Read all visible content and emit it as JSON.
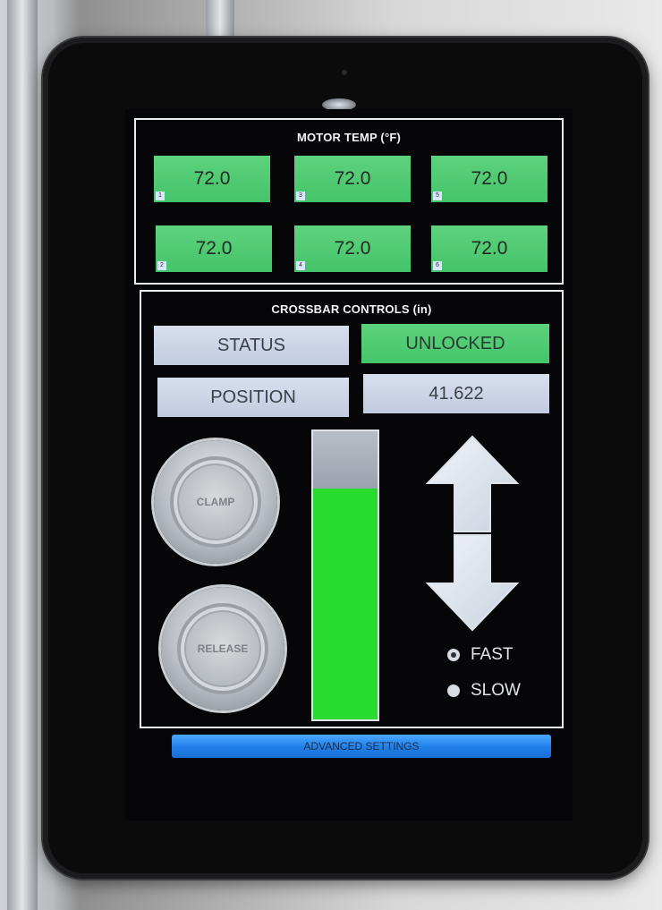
{
  "motor_temp": {
    "title": "MOTOR TEMP (°F)",
    "sensors": [
      {
        "index": "1",
        "value": "72.0"
      },
      {
        "index": "3",
        "value": "72.0"
      },
      {
        "index": "5",
        "value": "72.0"
      },
      {
        "index": "2",
        "value": "72.0"
      },
      {
        "index": "4",
        "value": "72.0"
      },
      {
        "index": "6",
        "value": "72.0"
      }
    ],
    "status_color": "#4ac86f"
  },
  "crossbar": {
    "title": "CROSSBAR CONTROLS (in)",
    "status_label": "STATUS",
    "status_value": "UNLOCKED",
    "position_label": "POSITION",
    "position_value": "41.622",
    "clamp_label": "CLAMP",
    "release_label": "RELEASE",
    "position_fraction": 0.8,
    "fill_color": "#27dc2f",
    "speed_options": [
      {
        "label": "FAST",
        "selected": true
      },
      {
        "label": "SLOW",
        "selected": false
      }
    ],
    "up_icon": "arrow-up-icon",
    "down_icon": "arrow-down-icon"
  },
  "advanced_settings_label": "ADVANCED SETTINGS"
}
